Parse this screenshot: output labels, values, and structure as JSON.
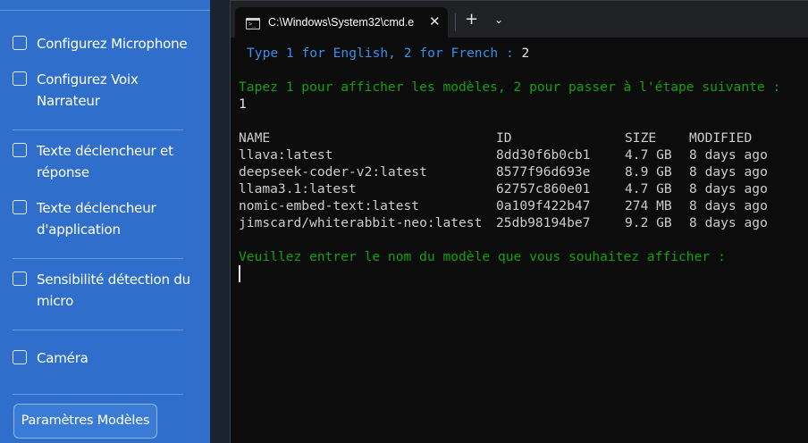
{
  "sidebar": {
    "items": [
      {
        "label": "Configurez Microphone"
      },
      {
        "label": "Configurez Voix Narrateur"
      },
      {
        "label": "Texte déclencheur et réponse"
      },
      {
        "label": "Texte déclencheur d'application"
      },
      {
        "label": "Sensibilité détection du micro"
      },
      {
        "label": "Caméra"
      }
    ],
    "button_label": "Paramètres Modèles"
  },
  "terminal": {
    "tab_title": "C:\\Windows\\System32\\cmd.e",
    "tab_icon_glyph": ">_",
    "close_glyph": "✕",
    "new_tab_glyph": "+",
    "dropdown_glyph": "⌄",
    "lang_prompt": "Type 1 for English, 2 for French : ",
    "lang_answer": "2",
    "menu_prompt": "Tapez 1 pour afficher les modèles, 2 pour passer à l'étape suivante :",
    "menu_answer": "1",
    "table": {
      "headers": [
        "NAME",
        "ID",
        "SIZE",
        "MODIFIED"
      ],
      "rows": [
        [
          "llava:latest",
          "8dd30f6b0cb1",
          "4.7 GB",
          "8 days ago"
        ],
        [
          "deepseek-coder-v2:latest",
          "8577f96d693e",
          "8.9 GB",
          "8 days ago"
        ],
        [
          "llama3.1:latest",
          "62757c860e01",
          "4.7 GB",
          "8 days ago"
        ],
        [
          "nomic-embed-text:latest",
          "0a109f422b47",
          "274 MB",
          "8 days ago"
        ],
        [
          "jimscard/whiterabbit-neo:latest",
          "25db98194be7",
          "9.2 GB",
          "8 days ago"
        ]
      ]
    },
    "model_prompt": "Veuillez entrer le nom du modèle que vous souhaitez afficher :"
  },
  "colors": {
    "sidebar_bg": "#2f6fcb",
    "terminal_bg": "#0c0c0c",
    "prompt_blue": "#3b8eea",
    "prompt_green": "#13a10e"
  }
}
